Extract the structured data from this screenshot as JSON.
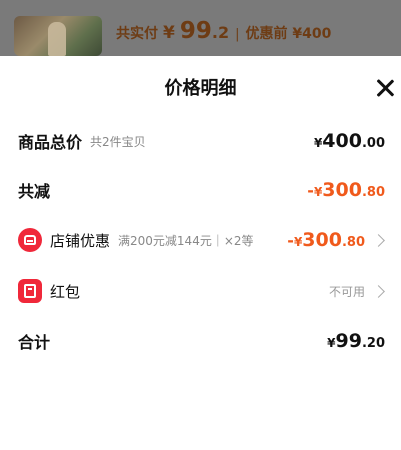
{
  "header": {
    "paid_label": "共实付",
    "paid_currency": "¥",
    "paid_integer": "99",
    "paid_decimal": ".2",
    "separator": "|",
    "before_discount": "优惠前 ¥400"
  },
  "sheet": {
    "title": "价格明细"
  },
  "rows": {
    "total": {
      "label": "商品总价",
      "sub": "共2件宝贝",
      "currency": "¥",
      "integer": "400",
      "decimal": ".00"
    },
    "reduction": {
      "label": "共减",
      "sign": "-",
      "currency": "¥",
      "integer": "300",
      "decimal": ".80"
    },
    "store_discount": {
      "label": "店铺优惠",
      "sub": "满200元减144元｜×2等",
      "sign": "-",
      "currency": "¥",
      "integer": "300",
      "decimal": ".80"
    },
    "red_packet": {
      "label": "红包",
      "status": "不可用"
    },
    "sum": {
      "label": "合计",
      "currency": "¥",
      "integer": "99",
      "decimal": ".20"
    }
  },
  "colors": {
    "accent": "#f05a1c",
    "icon_red": "#f0283a"
  },
  "icons": {
    "close": "close-icon",
    "store": "store-icon",
    "red_packet": "red-packet-icon",
    "chevron": "chevron-right-icon"
  }
}
